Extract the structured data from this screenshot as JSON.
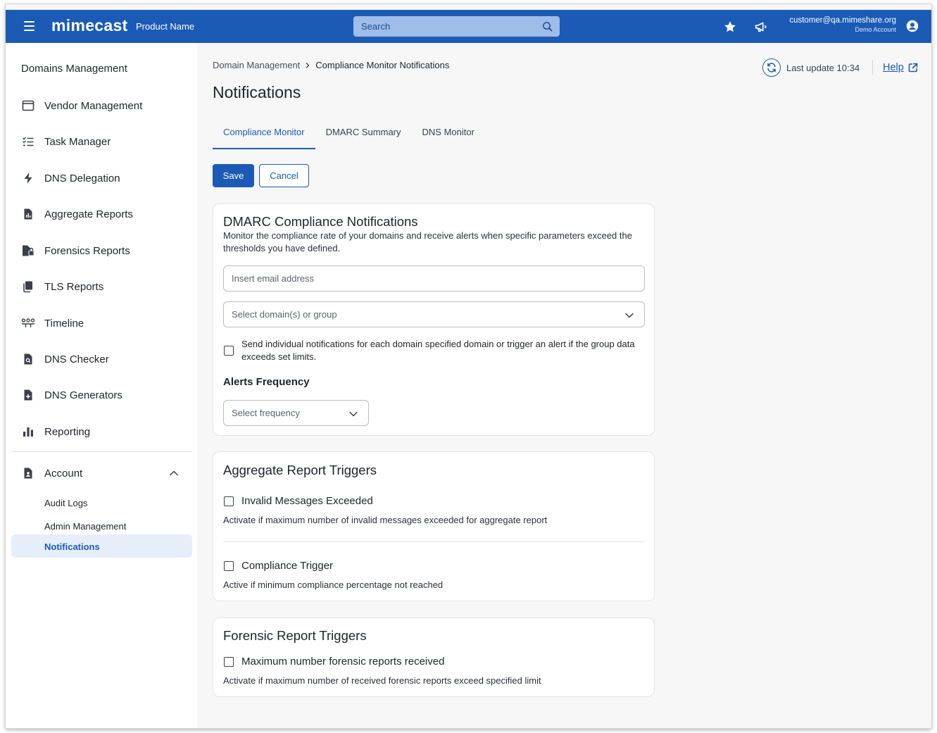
{
  "header": {
    "brand": "mimecast",
    "product_name": "Product Name",
    "search_placeholder": "Search",
    "user_email": "customer@qa.mimeshare.org",
    "user_account": "Demo Account"
  },
  "sidebar": {
    "title": "Domains Management",
    "items": [
      {
        "label": "Vendor Management",
        "icon": "window-icon"
      },
      {
        "label": "Task Manager",
        "icon": "checklist-icon"
      },
      {
        "label": "DNS Delegation",
        "icon": "lightning-icon"
      },
      {
        "label": "Aggregate Reports",
        "icon": "report-chart-icon"
      },
      {
        "label": "Forensics Reports",
        "icon": "forensics-report-icon"
      },
      {
        "label": "TLS Reports",
        "icon": "stack-documents-icon"
      },
      {
        "label": "Timeline",
        "icon": "timeline-icon"
      },
      {
        "label": "DNS Checker",
        "icon": "doc-search-icon"
      },
      {
        "label": "DNS Generators",
        "icon": "doc-plus-icon"
      },
      {
        "label": "Reporting",
        "icon": "bar-chart-icon"
      }
    ],
    "account": {
      "label": "Account",
      "sub_items": [
        "Audit Logs",
        "Admin Management"
      ],
      "active_item": "Notifications"
    }
  },
  "breadcrumb": {
    "parent": "Domain Management",
    "current": "Compliance Monitor Notifications"
  },
  "page_title": "Notifications",
  "last_update": "Last update 10:34",
  "help_label": "Help",
  "tabs": [
    {
      "label": "Compliance Monitor",
      "active": true
    },
    {
      "label": "DMARC Summary",
      "active": false
    },
    {
      "label": "DNS Monitor",
      "active": false
    }
  ],
  "actions": {
    "save": "Save",
    "cancel": "Cancel"
  },
  "dmarc_card": {
    "title": "DMARC Compliance Notifications",
    "description": "Monitor the compliance rate of your domains and receive alerts when specific parameters exceed the thresholds you have defined.",
    "email_placeholder": "Insert email address",
    "domain_select_placeholder": "Select domain(s) or group",
    "individual_checkbox_label": "Send individual notifications for each domain specified domain or trigger an alert if the group data exceeds set limits.",
    "alerts_frequency_title": "Alerts Frequency",
    "frequency_placeholder": "Select frequency"
  },
  "aggregate_card": {
    "title": "Aggregate Report Triggers",
    "triggers": [
      {
        "label": "Invalid Messages Exceeded",
        "description": "Activate if maximum number of invalid messages exceeded for aggregate report"
      },
      {
        "label": "Compliance Trigger",
        "description": "Active if minimum compliance percentage not reached"
      }
    ]
  },
  "forensic_card": {
    "title": "Forensic Report Triggers",
    "triggers": [
      {
        "label": "Maximum number forensic reports received",
        "description": "Activate if maximum number of received forensic reports exceed specified limit"
      }
    ]
  },
  "colors": {
    "brand_blue": "#1b5bb5",
    "active_bg": "#e6eefa"
  }
}
